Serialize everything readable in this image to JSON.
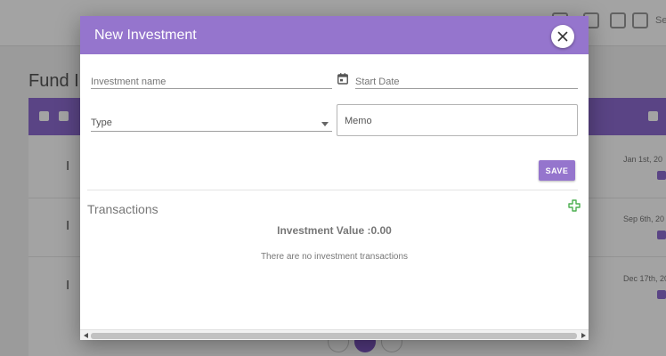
{
  "background": {
    "page_title": "Fund In",
    "row_letter": "I",
    "topbar_trailing_text": "Se",
    "row_dates": [
      "Jan 1st, 20",
      "Sep 6th, 20",
      "Dec 17th, 20"
    ],
    "pager_active": "1"
  },
  "modal": {
    "title": "New Investment",
    "close_icon": "close-icon",
    "fields": {
      "investment_name_placeholder": "Investment name",
      "start_date_placeholder": "Start Date",
      "start_date_icon": "calendar-icon",
      "type_placeholder": "Type",
      "type_icon": "dropdown-arrow-icon",
      "memo_placeholder": "Memo"
    },
    "save_label": "SAVE",
    "transactions": {
      "title": "Transactions",
      "add_icon": "plus-icon",
      "investment_value": "Investment Value :0.00",
      "empty_message": "There are no investment transactions"
    }
  },
  "colors": {
    "accent": "#9575cd",
    "add_green": "#4caf50",
    "overlay": "rgba(0,0,0,0.36)"
  }
}
